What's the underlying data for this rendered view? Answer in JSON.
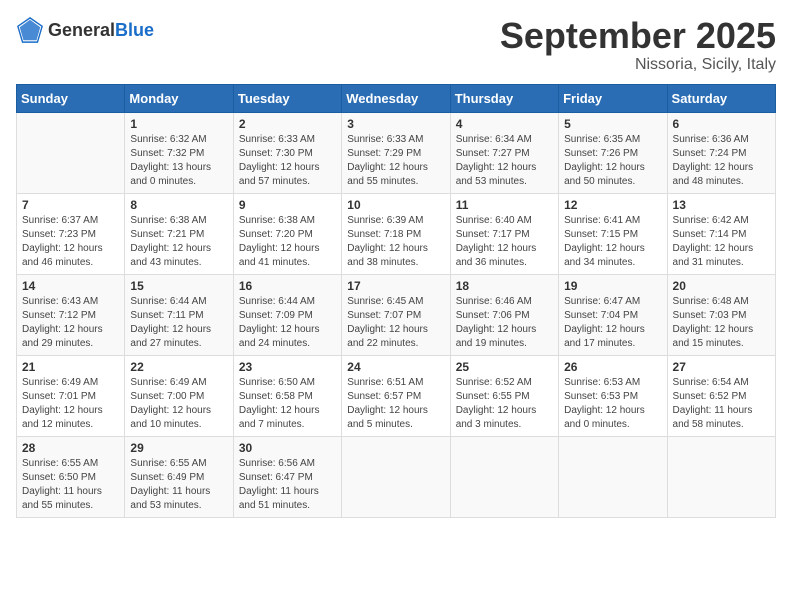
{
  "header": {
    "logo_general": "General",
    "logo_blue": "Blue",
    "month": "September 2025",
    "location": "Nissoria, Sicily, Italy"
  },
  "weekdays": [
    "Sunday",
    "Monday",
    "Tuesday",
    "Wednesday",
    "Thursday",
    "Friday",
    "Saturday"
  ],
  "weeks": [
    [
      {
        "day": "",
        "content": ""
      },
      {
        "day": "1",
        "content": "Sunrise: 6:32 AM\nSunset: 7:32 PM\nDaylight: 13 hours\nand 0 minutes."
      },
      {
        "day": "2",
        "content": "Sunrise: 6:33 AM\nSunset: 7:30 PM\nDaylight: 12 hours\nand 57 minutes."
      },
      {
        "day": "3",
        "content": "Sunrise: 6:33 AM\nSunset: 7:29 PM\nDaylight: 12 hours\nand 55 minutes."
      },
      {
        "day": "4",
        "content": "Sunrise: 6:34 AM\nSunset: 7:27 PM\nDaylight: 12 hours\nand 53 minutes."
      },
      {
        "day": "5",
        "content": "Sunrise: 6:35 AM\nSunset: 7:26 PM\nDaylight: 12 hours\nand 50 minutes."
      },
      {
        "day": "6",
        "content": "Sunrise: 6:36 AM\nSunset: 7:24 PM\nDaylight: 12 hours\nand 48 minutes."
      }
    ],
    [
      {
        "day": "7",
        "content": "Sunrise: 6:37 AM\nSunset: 7:23 PM\nDaylight: 12 hours\nand 46 minutes."
      },
      {
        "day": "8",
        "content": "Sunrise: 6:38 AM\nSunset: 7:21 PM\nDaylight: 12 hours\nand 43 minutes."
      },
      {
        "day": "9",
        "content": "Sunrise: 6:38 AM\nSunset: 7:20 PM\nDaylight: 12 hours\nand 41 minutes."
      },
      {
        "day": "10",
        "content": "Sunrise: 6:39 AM\nSunset: 7:18 PM\nDaylight: 12 hours\nand 38 minutes."
      },
      {
        "day": "11",
        "content": "Sunrise: 6:40 AM\nSunset: 7:17 PM\nDaylight: 12 hours\nand 36 minutes."
      },
      {
        "day": "12",
        "content": "Sunrise: 6:41 AM\nSunset: 7:15 PM\nDaylight: 12 hours\nand 34 minutes."
      },
      {
        "day": "13",
        "content": "Sunrise: 6:42 AM\nSunset: 7:14 PM\nDaylight: 12 hours\nand 31 minutes."
      }
    ],
    [
      {
        "day": "14",
        "content": "Sunrise: 6:43 AM\nSunset: 7:12 PM\nDaylight: 12 hours\nand 29 minutes."
      },
      {
        "day": "15",
        "content": "Sunrise: 6:44 AM\nSunset: 7:11 PM\nDaylight: 12 hours\nand 27 minutes."
      },
      {
        "day": "16",
        "content": "Sunrise: 6:44 AM\nSunset: 7:09 PM\nDaylight: 12 hours\nand 24 minutes."
      },
      {
        "day": "17",
        "content": "Sunrise: 6:45 AM\nSunset: 7:07 PM\nDaylight: 12 hours\nand 22 minutes."
      },
      {
        "day": "18",
        "content": "Sunrise: 6:46 AM\nSunset: 7:06 PM\nDaylight: 12 hours\nand 19 minutes."
      },
      {
        "day": "19",
        "content": "Sunrise: 6:47 AM\nSunset: 7:04 PM\nDaylight: 12 hours\nand 17 minutes."
      },
      {
        "day": "20",
        "content": "Sunrise: 6:48 AM\nSunset: 7:03 PM\nDaylight: 12 hours\nand 15 minutes."
      }
    ],
    [
      {
        "day": "21",
        "content": "Sunrise: 6:49 AM\nSunset: 7:01 PM\nDaylight: 12 hours\nand 12 minutes."
      },
      {
        "day": "22",
        "content": "Sunrise: 6:49 AM\nSunset: 7:00 PM\nDaylight: 12 hours\nand 10 minutes."
      },
      {
        "day": "23",
        "content": "Sunrise: 6:50 AM\nSunset: 6:58 PM\nDaylight: 12 hours\nand 7 minutes."
      },
      {
        "day": "24",
        "content": "Sunrise: 6:51 AM\nSunset: 6:57 PM\nDaylight: 12 hours\nand 5 minutes."
      },
      {
        "day": "25",
        "content": "Sunrise: 6:52 AM\nSunset: 6:55 PM\nDaylight: 12 hours\nand 3 minutes."
      },
      {
        "day": "26",
        "content": "Sunrise: 6:53 AM\nSunset: 6:53 PM\nDaylight: 12 hours\nand 0 minutes."
      },
      {
        "day": "27",
        "content": "Sunrise: 6:54 AM\nSunset: 6:52 PM\nDaylight: 11 hours\nand 58 minutes."
      }
    ],
    [
      {
        "day": "28",
        "content": "Sunrise: 6:55 AM\nSunset: 6:50 PM\nDaylight: 11 hours\nand 55 minutes."
      },
      {
        "day": "29",
        "content": "Sunrise: 6:55 AM\nSunset: 6:49 PM\nDaylight: 11 hours\nand 53 minutes."
      },
      {
        "day": "30",
        "content": "Sunrise: 6:56 AM\nSunset: 6:47 PM\nDaylight: 11 hours\nand 51 minutes."
      },
      {
        "day": "",
        "content": ""
      },
      {
        "day": "",
        "content": ""
      },
      {
        "day": "",
        "content": ""
      },
      {
        "day": "",
        "content": ""
      }
    ]
  ]
}
